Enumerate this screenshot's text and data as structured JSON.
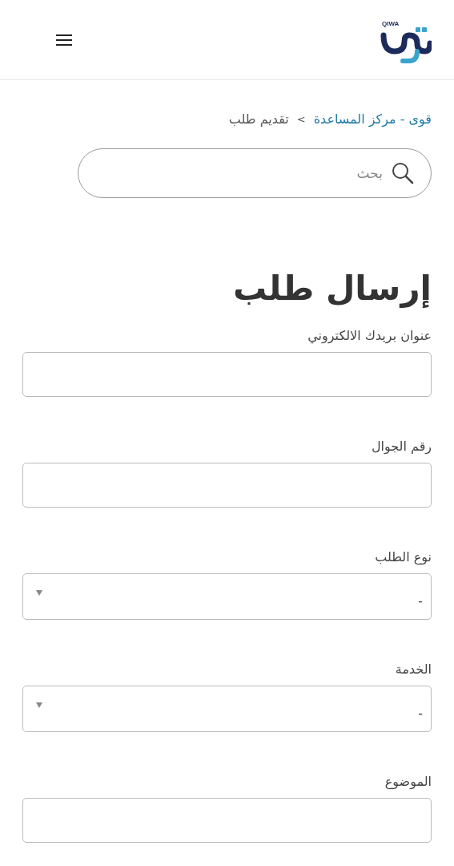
{
  "header": {
    "logo_text": "QIWA"
  },
  "breadcrumb": [
    {
      "kind": "link",
      "text": "قوى - مركز المساعدة"
    },
    {
      "kind": "separator",
      "text": ">"
    },
    {
      "kind": "current",
      "text": "تقديم طلب"
    }
  ],
  "search": {
    "placeholder": "بحث"
  },
  "title": "إرسال طلب",
  "fields": [
    {
      "kind": "text",
      "label": "عنوان بريدك الالكتروني"
    },
    {
      "kind": "text",
      "label": "رقم الجوال"
    },
    {
      "kind": "select",
      "label": "نوع الطلب",
      "value": "-"
    },
    {
      "kind": "select",
      "label": "الخدمة",
      "value": "-"
    },
    {
      "kind": "text",
      "label": "الموضوع"
    }
  ]
}
